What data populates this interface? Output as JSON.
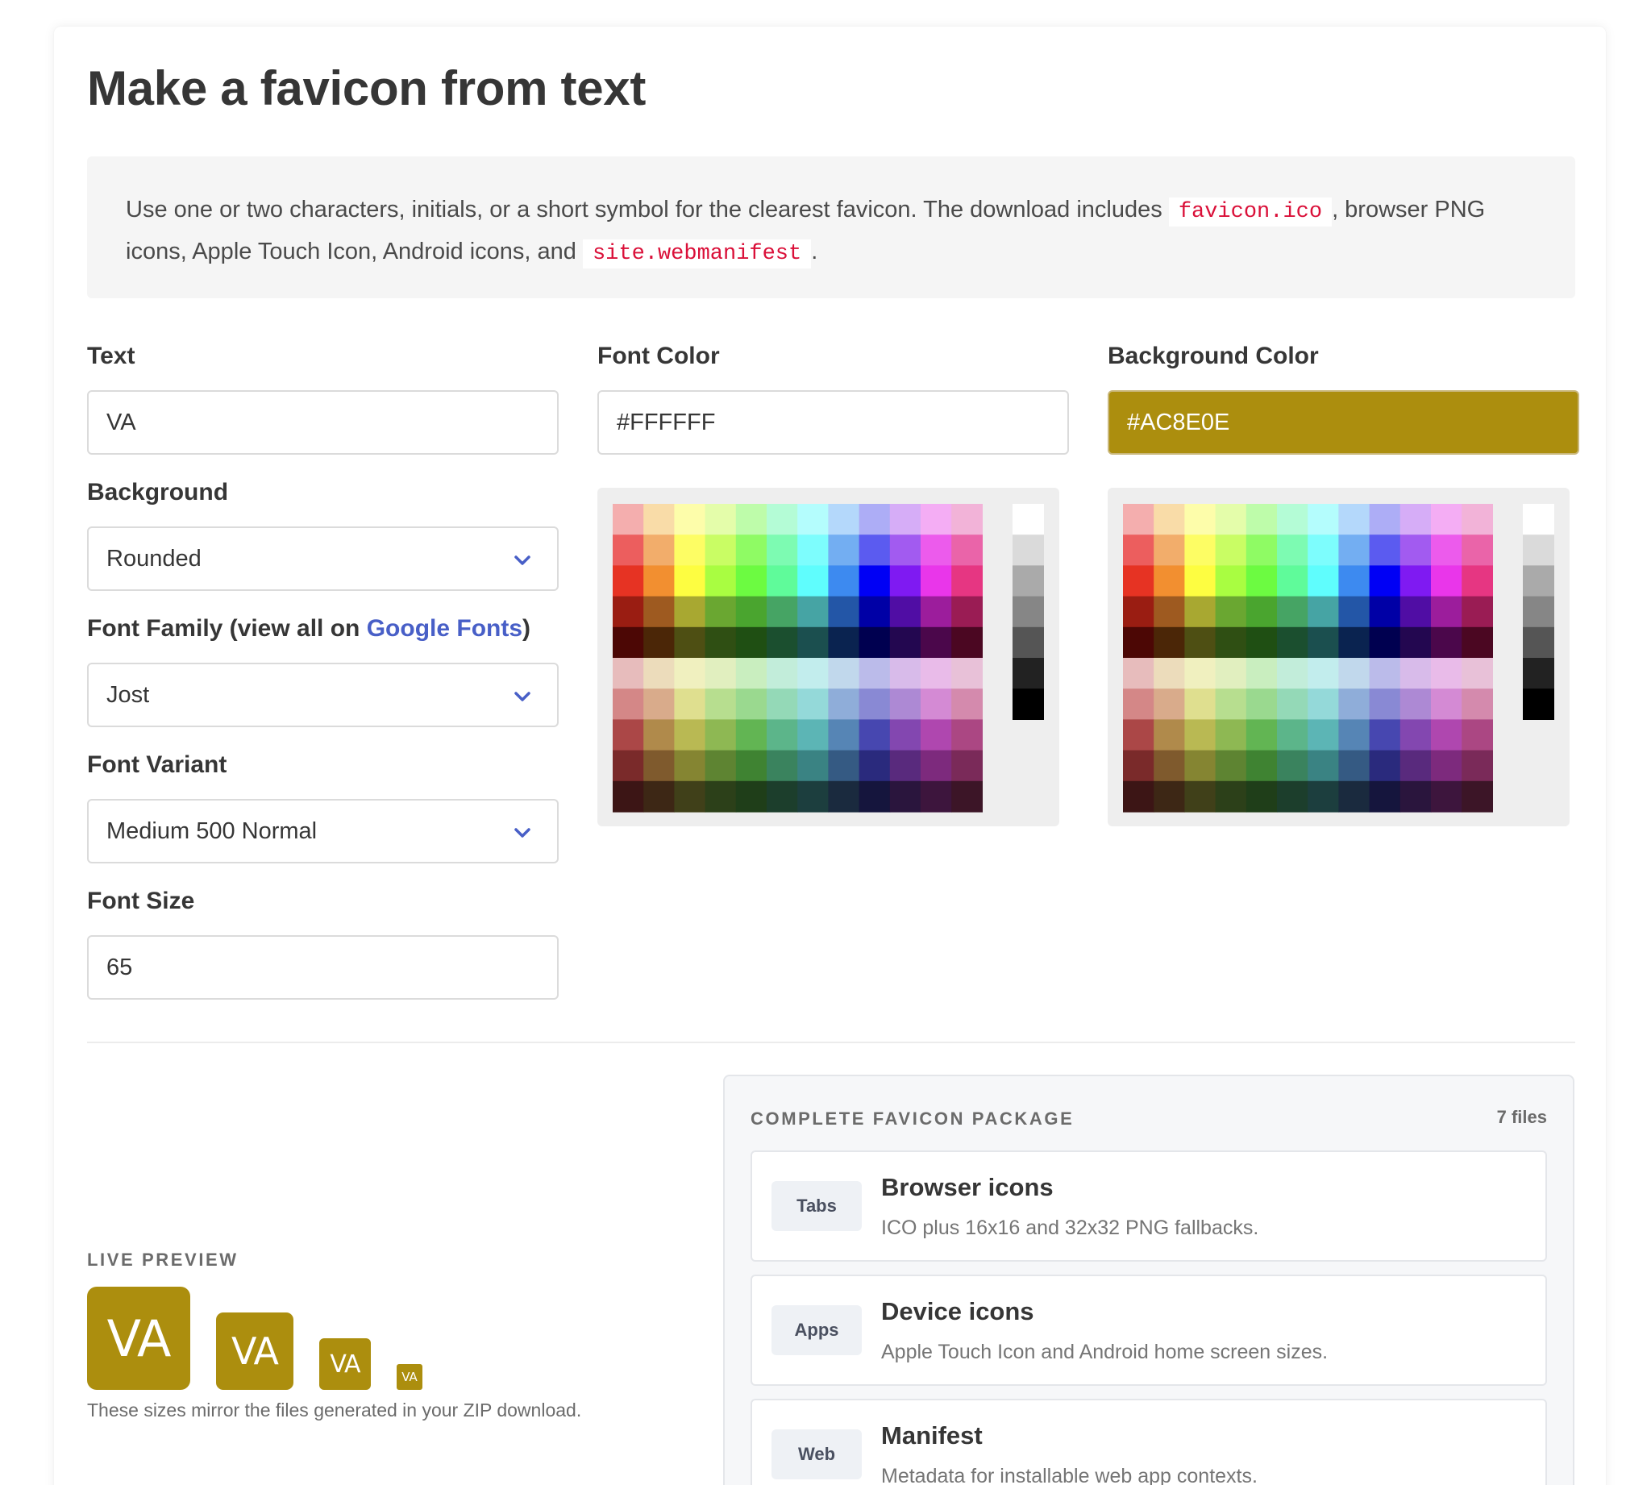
{
  "page": {
    "title": "Make a favicon from text"
  },
  "notice": {
    "text_before": "Use one or two characters, initials, or a short symbol for the clearest favicon. The download includes ",
    "file1": "favicon.ico",
    "text_middle": ", browser PNG icons, Apple Touch Icon, Android icons, and ",
    "file2": "site.webmanifest",
    "text_after": "."
  },
  "form": {
    "text": {
      "label": "Text",
      "value": "VA"
    },
    "background": {
      "label": "Background",
      "value": "Rounded"
    },
    "font_family": {
      "label_before": "Font Family (view all on ",
      "link": "Google Fonts",
      "label_after": ")",
      "value": "Jost"
    },
    "font_variant": {
      "label": "Font Variant",
      "value": "Medium 500 Normal"
    },
    "font_size": {
      "label": "Font Size",
      "value": "65"
    },
    "font_color": {
      "label": "Font Color",
      "value": "#FFFFFF"
    },
    "background_color": {
      "label": "Background Color",
      "value": "#AC8E0E"
    }
  },
  "colors": {
    "accent_link": "#485fc7",
    "code_red": "#da1039",
    "swatch_bg": "#ac8e0e",
    "swatch_fg": "#ffffff"
  },
  "palette": {
    "rows": [
      [
        "#f4aeae",
        "#f9dca8",
        "#fdfdaa",
        "#e4fdaa",
        "#befcaa",
        "#b4fcd6",
        "#b4fdfd",
        "#b4d8fb",
        "#adadf6",
        "#d6adf7",
        "#f4adf4",
        "#f2b3d8"
      ],
      [
        "#ec5e5e",
        "#f2ad6b",
        "#fdfd64",
        "#c9fd64",
        "#8ffb64",
        "#7dfbb2",
        "#7dfdfd",
        "#73aef2",
        "#5b5bf0",
        "#a25bf0",
        "#ec5bec",
        "#ea64a9"
      ],
      [
        "#e63323",
        "#f28f30",
        "#fdfd41",
        "#a9fd41",
        "#6cfb41",
        "#5ffb9a",
        "#5ffdfd",
        "#3d8af0",
        "#0000f5",
        "#7f1af2",
        "#e936ea",
        "#e63682"
      ],
      [
        "#9a1d12",
        "#9e5a20",
        "#a8a831",
        "#6aa731",
        "#4aa52f",
        "#46a464",
        "#46a4a4",
        "#2356a7",
        "#0000a6",
        "#500da4",
        "#9c1d9c",
        "#9a1c54"
      ],
      [
        "#4c0705",
        "#4b2607",
        "#4e4f13",
        "#2f4f13",
        "#1f4f13",
        "#1b4f2f",
        "#1b4f4f",
        "#0a2350",
        "#000050",
        "#230750",
        "#4b074b",
        "#4b0722"
      ],
      [
        "#e7bcbc",
        "#ecdcbb",
        "#f0f0bf",
        "#e1efbf",
        "#c9eebf",
        "#c2edda",
        "#c2eded",
        "#c1d8ec",
        "#bbbbea",
        "#d8bbea",
        "#e9bbe9",
        "#e8c1d8"
      ],
      [
        "#d48787",
        "#d9ab8b",
        "#dfdf8f",
        "#b7de8f",
        "#9ad98f",
        "#94d9b7",
        "#94d9d9",
        "#8fadd9",
        "#8989d4",
        "#ad89d4",
        "#d48ad4",
        "#d48aad"
      ],
      [
        "#ab4747",
        "#b08a4b",
        "#b9b953",
        "#8eb853",
        "#62b553",
        "#5cb58a",
        "#5cb5b5",
        "#5685b5",
        "#4747b0",
        "#8347b0",
        "#af47af",
        "#ab4783"
      ],
      [
        "#7a2a2a",
        "#7f5a2d",
        "#858532",
        "#5e8432",
        "#3f8332",
        "#3a835e",
        "#3a8383",
        "#355a83",
        "#2a2a7d",
        "#592a7d",
        "#7d2a7d",
        "#7a2a59"
      ],
      [
        "#3c1515",
        "#3d2715",
        "#404019",
        "#2c4019",
        "#1f3e19",
        "#1c3e2c",
        "#1c3e3e",
        "#1a2a3e",
        "#15153d",
        "#2a153d",
        "#3d153d",
        "#3c1527"
      ]
    ],
    "grays": [
      "#ffffff",
      "#dadada",
      "#aaaaaa",
      "#868686",
      "#555555",
      "#222222",
      "#000000"
    ]
  },
  "preview": {
    "caption": "LIVE PREVIEW",
    "text": "VA",
    "note": "These sizes mirror the files generated in your ZIP download."
  },
  "package": {
    "title": "COMPLETE FAVICON PACKAGE",
    "count": "7 files",
    "items": [
      {
        "tag": "Tabs",
        "title": "Browser icons",
        "desc": "ICO plus 16x16 and 32x32 PNG fallbacks."
      },
      {
        "tag": "Apps",
        "title": "Device icons",
        "desc": "Apple Touch Icon and Android home screen sizes."
      },
      {
        "tag": "Web",
        "title": "Manifest",
        "desc": "Metadata for installable web app contexts."
      }
    ]
  }
}
